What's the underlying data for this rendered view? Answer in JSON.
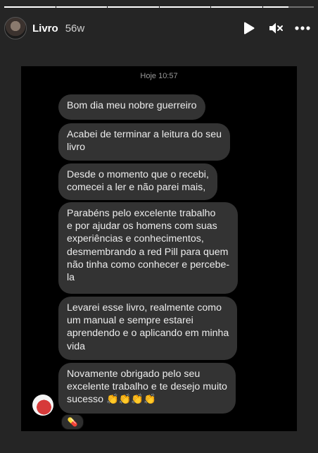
{
  "story": {
    "username": "Livro",
    "time_ago": "56w",
    "progress_segments": 6,
    "active_segment": 6,
    "active_progress": 0.5
  },
  "icons": {
    "play": "play-icon",
    "mute": "speaker-muted-icon",
    "more": "more-icon"
  },
  "chat": {
    "date": "Hoje 10:57",
    "messages": [
      "Bom dia meu nobre guerreiro",
      "Acabei de terminar a leitura do seu\nlivro",
      "Desde o momento que o recebi,\ncomecei a ler e não parei mais,",
      "Parabéns pelo excelente trabalho\ne por ajudar os homens com suas\nexperiências e conhecimentos,\ndesmembrando a red Pill para quem\nnão tinha como conhecer e percebe-\nla",
      "Levarei esse livro, realmente como\num manual e sempre estarei\naprendendo e o aplicando em minha\nvida",
      "Novamente obrigado pelo seu\nexcelente trabalho e te desejo muito\nsucesso 👏👏👏👏"
    ],
    "reaction": "💊"
  },
  "colors": {
    "background": "#252525",
    "bubble": "#333333",
    "bubble_text": "#ececec"
  }
}
